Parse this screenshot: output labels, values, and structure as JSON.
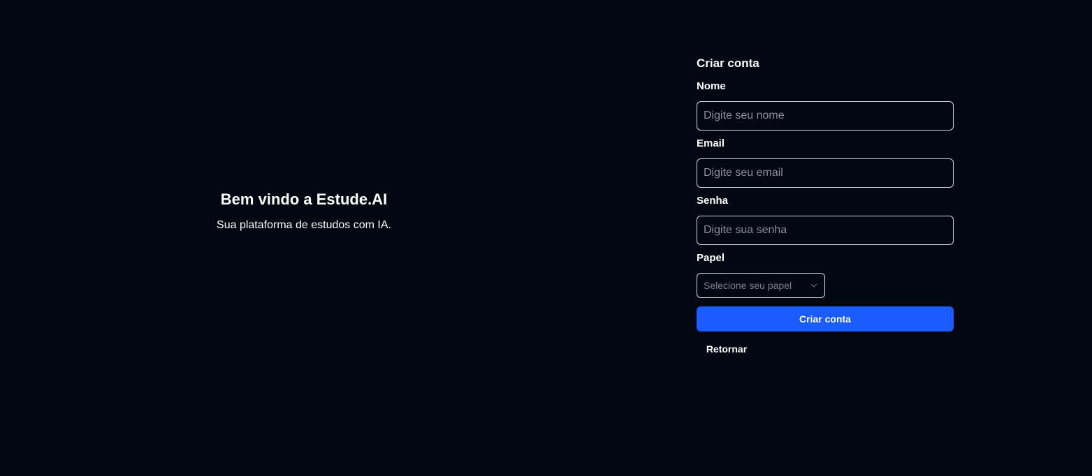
{
  "hero": {
    "title": "Bem vindo a Estude.AI",
    "subtitle": "Sua plataforma de estudos com IA."
  },
  "form": {
    "title": "Criar conta",
    "name": {
      "label": "Nome",
      "placeholder": "Digite seu nome",
      "value": ""
    },
    "email": {
      "label": "Email",
      "placeholder": "Digite seu email",
      "value": ""
    },
    "password": {
      "label": "Senha",
      "placeholder": "Digite sua senha",
      "value": ""
    },
    "role": {
      "label": "Papel",
      "placeholder": "Selecione seu papel",
      "icon": "chevron-down-icon"
    },
    "submit_label": "Criar conta",
    "back_label": "Retornar"
  },
  "colors": {
    "background": "#020712",
    "primary_button": "#1a5cff",
    "input_border": "#d6d9e0",
    "placeholder": "#8a8f99"
  }
}
